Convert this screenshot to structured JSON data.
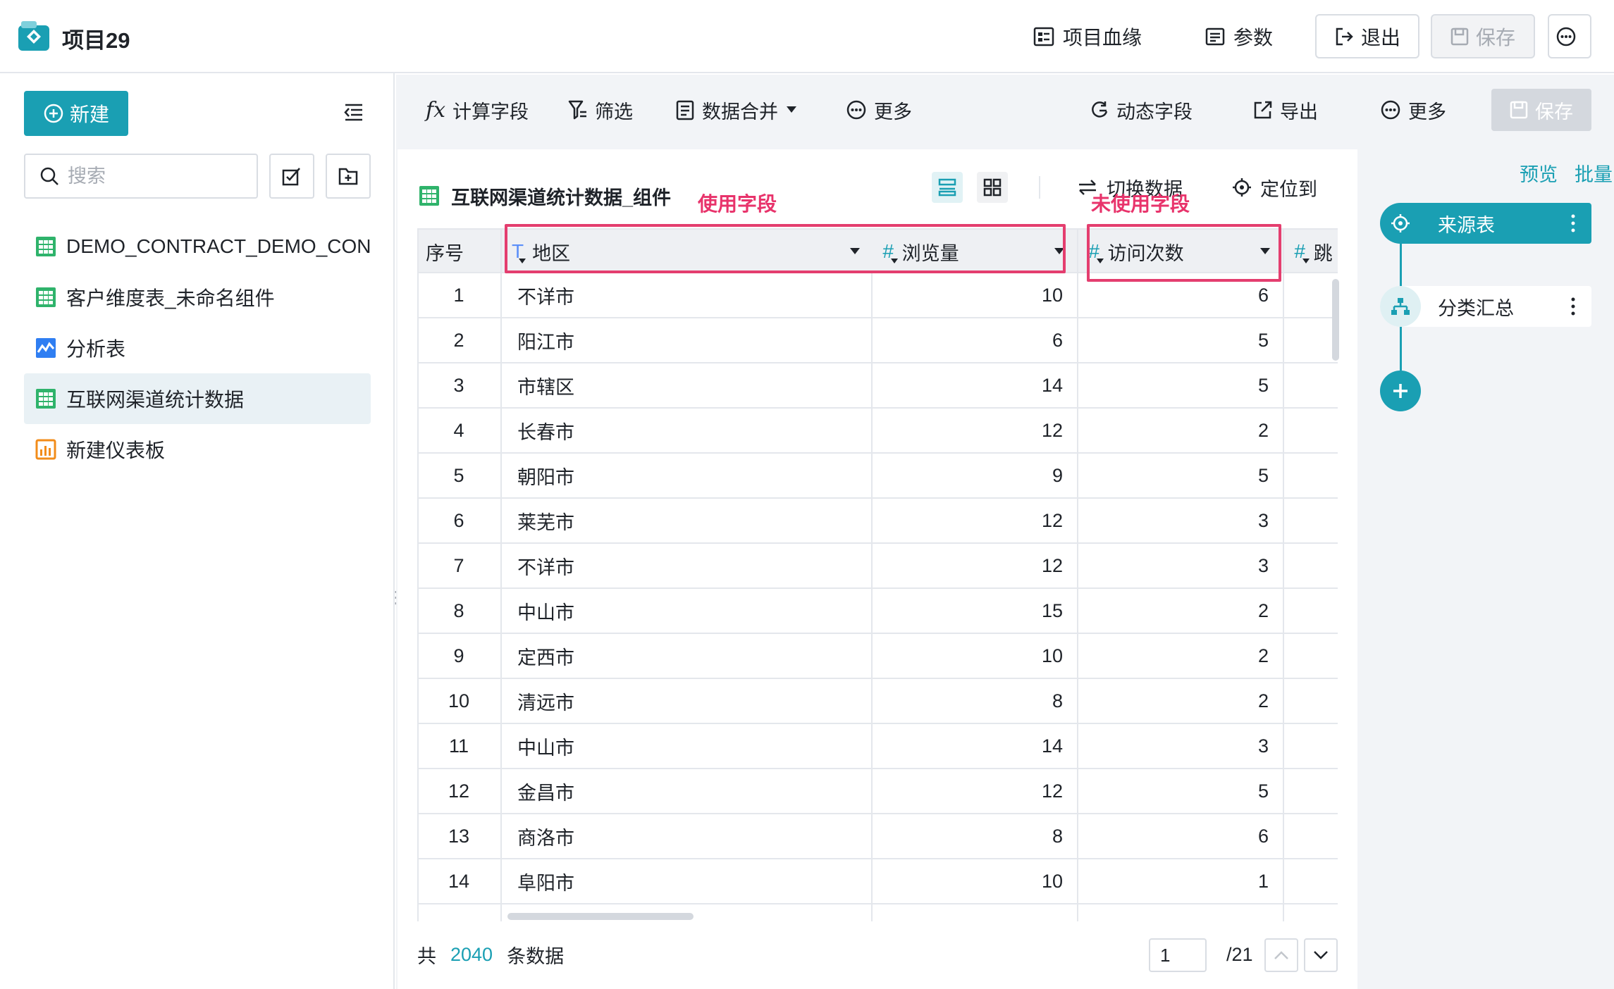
{
  "header": {
    "project_title": "项目29",
    "lineage_label": "项目血缘",
    "params_label": "参数",
    "exit_label": "退出",
    "save_label": "保存"
  },
  "sidebar": {
    "new_label": "新建",
    "search_placeholder": "搜索",
    "items": [
      {
        "label": "DEMO_CONTRACT_DEMO_CONT",
        "icon": "table-icon"
      },
      {
        "label": "客户维度表_未命名组件",
        "icon": "table-icon"
      },
      {
        "label": "分析表",
        "icon": "analysis-icon"
      },
      {
        "label": "互联网渠道统计数据",
        "icon": "table-icon",
        "active": true
      },
      {
        "label": "新建仪表板",
        "icon": "dashboard-icon"
      }
    ]
  },
  "toolbar": {
    "calc_field": "计算字段",
    "filter": "筛选",
    "merge": "数据合并",
    "more_left": "更多",
    "dynamic_field": "动态字段",
    "export": "导出",
    "more_right": "更多",
    "save": "保存"
  },
  "panel": {
    "title": "互联网渠道统计数据_组件",
    "switch_data": "切换数据",
    "locate": "定位到",
    "annotation_used": "使用字段",
    "annotation_unused": "未使用字段"
  },
  "table": {
    "columns": [
      "序号",
      "地区",
      "浏览量",
      "访问次数",
      "跳"
    ],
    "rows": [
      {
        "idx": "1",
        "region": "不详市",
        "views": "10",
        "visits": "6"
      },
      {
        "idx": "2",
        "region": "阳江市",
        "views": "6",
        "visits": "5"
      },
      {
        "idx": "3",
        "region": "市辖区",
        "views": "14",
        "visits": "5"
      },
      {
        "idx": "4",
        "region": "长春市",
        "views": "12",
        "visits": "2"
      },
      {
        "idx": "5",
        "region": "朝阳市",
        "views": "9",
        "visits": "5"
      },
      {
        "idx": "6",
        "region": "莱芜市",
        "views": "12",
        "visits": "3"
      },
      {
        "idx": "7",
        "region": "不详市",
        "views": "12",
        "visits": "3"
      },
      {
        "idx": "8",
        "region": "中山市",
        "views": "15",
        "visits": "2"
      },
      {
        "idx": "9",
        "region": "定西市",
        "views": "10",
        "visits": "2"
      },
      {
        "idx": "10",
        "region": "清远市",
        "views": "8",
        "visits": "2"
      },
      {
        "idx": "11",
        "region": "中山市",
        "views": "14",
        "visits": "3"
      },
      {
        "idx": "12",
        "region": "金昌市",
        "views": "12",
        "visits": "5"
      },
      {
        "idx": "13",
        "region": "商洛市",
        "views": "8",
        "visits": "6"
      },
      {
        "idx": "14",
        "region": "阜阳市",
        "views": "10",
        "visits": "1"
      }
    ]
  },
  "footer": {
    "prefix": "共",
    "total": "2040",
    "suffix": "条数据",
    "page": "1",
    "page_total": "/21"
  },
  "flow": {
    "tab_preview": "预览",
    "tab_batch": "批量",
    "node_source": "来源表",
    "node_agg": "分类汇总"
  },
  "colors": {
    "accent": "#1a9fb3",
    "annotation": "#e43e6f"
  }
}
